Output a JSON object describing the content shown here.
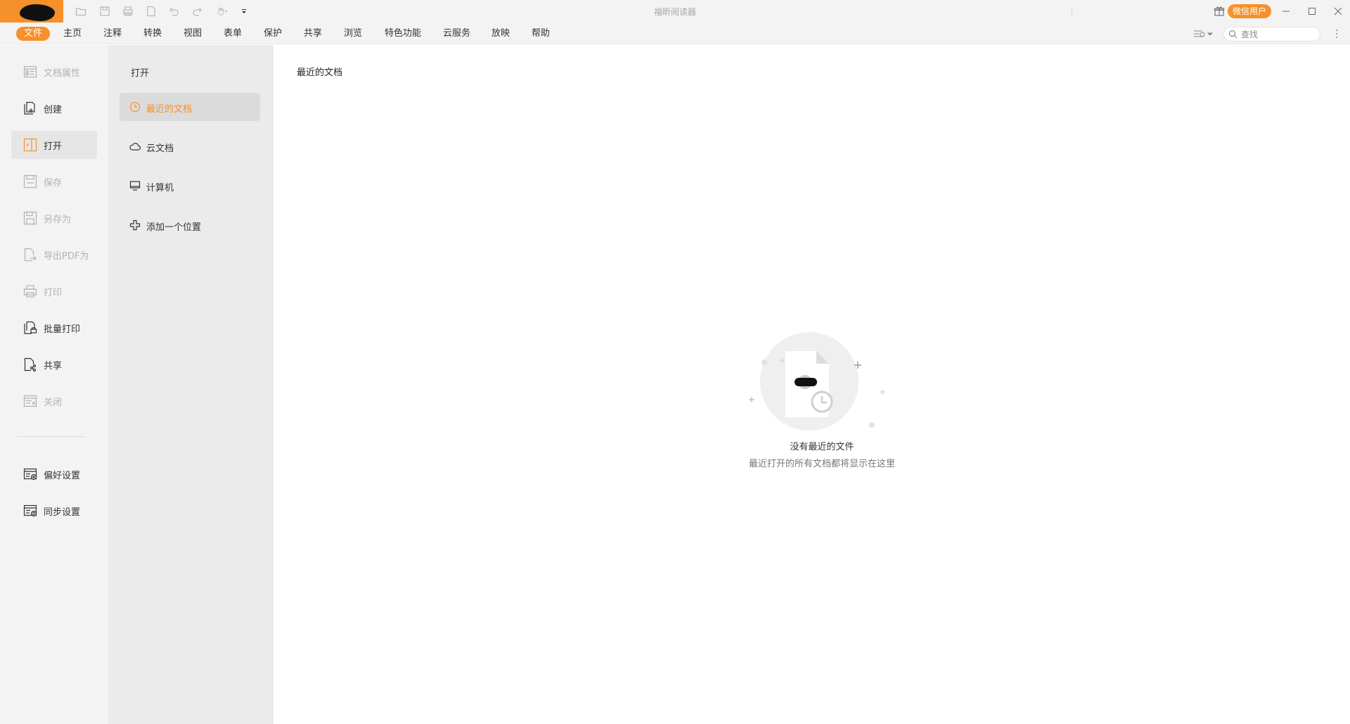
{
  "titlebar": {
    "app_title": "福昕阅读器",
    "user_label": "微信用户",
    "quick_access_icons": [
      "open-folder-icon",
      "save-icon",
      "print-icon",
      "new-doc-icon",
      "undo-icon",
      "redo-icon",
      "hand-tool-icon",
      "customize-dropdown-icon"
    ]
  },
  "menubar": {
    "tabs": [
      {
        "label": "文件",
        "active": true
      },
      {
        "label": "主页"
      },
      {
        "label": "注释"
      },
      {
        "label": "转换"
      },
      {
        "label": "视图"
      },
      {
        "label": "表单"
      },
      {
        "label": "保护"
      },
      {
        "label": "共享"
      },
      {
        "label": "浏览"
      },
      {
        "label": "特色功能"
      },
      {
        "label": "云服务"
      },
      {
        "label": "放映"
      },
      {
        "label": "帮助"
      }
    ],
    "search_placeholder": "查找"
  },
  "leftnav": {
    "items": [
      {
        "label": "文档属性",
        "icon": "doc-properties-icon",
        "enabled": false
      },
      {
        "label": "创建",
        "icon": "create-icon",
        "enabled": true
      },
      {
        "label": "打开",
        "icon": "open-icon",
        "enabled": true,
        "active": true
      },
      {
        "label": "保存",
        "icon": "save-icon",
        "enabled": false
      },
      {
        "label": "另存为",
        "icon": "save-as-icon",
        "enabled": false
      },
      {
        "label": "导出PDF为",
        "icon": "export-pdf-icon",
        "enabled": false
      },
      {
        "label": "打印",
        "icon": "print-icon",
        "enabled": false
      },
      {
        "label": "批量打印",
        "icon": "batch-print-icon",
        "enabled": true
      },
      {
        "label": "共享",
        "icon": "share-icon",
        "enabled": true
      },
      {
        "label": "关闭",
        "icon": "close-doc-icon",
        "enabled": false
      }
    ],
    "settings": [
      {
        "label": "偏好设置",
        "icon": "preferences-icon"
      },
      {
        "label": "同步设置",
        "icon": "sync-settings-icon"
      }
    ]
  },
  "midpanel": {
    "heading": "打开",
    "items": [
      {
        "label": "最近的文档",
        "icon": "clock-icon",
        "active": true
      },
      {
        "label": "云文档",
        "icon": "cloud-icon"
      },
      {
        "label": "计算机",
        "icon": "monitor-icon"
      },
      {
        "label": "添加一个位置",
        "icon": "plus-icon"
      }
    ]
  },
  "content": {
    "title": "最近的文档",
    "empty_title": "没有最近的文件",
    "empty_subtitle": "最近打开的所有文档都将显示在这里"
  },
  "colors": {
    "accent": "#f6902a",
    "chrome_bg": "#f3f3f3",
    "panel_bg": "#ebebeb"
  }
}
